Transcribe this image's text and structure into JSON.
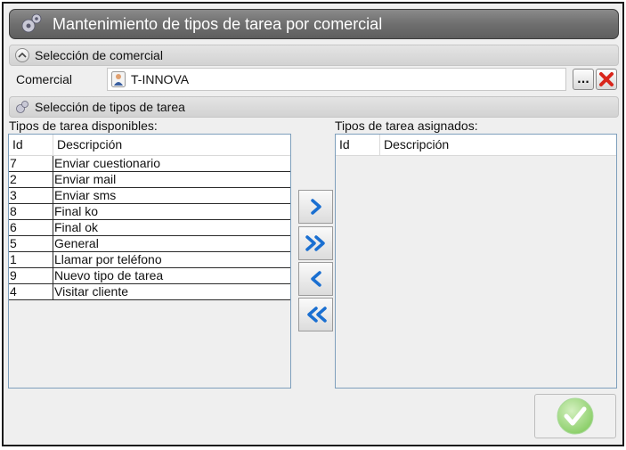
{
  "window": {
    "title": "Mantenimiento de tipos de tarea por comercial"
  },
  "comercial_section": {
    "header": "Selección de comercial",
    "field_label": "Comercial",
    "value": "T-INNOVA",
    "browse_label": "..."
  },
  "tipos_section": {
    "header": "Selección de tipos de tarea"
  },
  "available": {
    "label": "Tipos de tarea disponibles:",
    "col_id": "Id",
    "col_desc": "Descripción",
    "rows": [
      {
        "id": "7",
        "desc": "Enviar cuestionario"
      },
      {
        "id": "2",
        "desc": "Enviar mail"
      },
      {
        "id": "3",
        "desc": "Enviar sms"
      },
      {
        "id": "8",
        "desc": "Final ko"
      },
      {
        "id": "6",
        "desc": "Final ok"
      },
      {
        "id": "5",
        "desc": "General"
      },
      {
        "id": "1",
        "desc": "Llamar por teléfono"
      },
      {
        "id": "9",
        "desc": "Nuevo tipo de tarea"
      },
      {
        "id": "4",
        "desc": "Visitar cliente"
      }
    ]
  },
  "assigned": {
    "label": "Tipos de tarea asignados:",
    "col_id": "Id",
    "col_desc": "Descripción",
    "rows": []
  },
  "icons": {
    "title": "gear-icon",
    "collapse": "chevron-up-icon",
    "comercial": "person-icon",
    "remove": "red-x-icon",
    "move_one_right": "chevron-right-icon",
    "move_all_right": "double-chevron-right-icon",
    "move_one_left": "chevron-left-icon",
    "move_all_left": "double-chevron-left-icon",
    "accept": "check-icon"
  },
  "colors": {
    "titlebar": "#6f6f6f",
    "arrow_blue": "#1a6fd1",
    "remove_red": "#d9261c",
    "accept_green": "#8ccf6a"
  }
}
